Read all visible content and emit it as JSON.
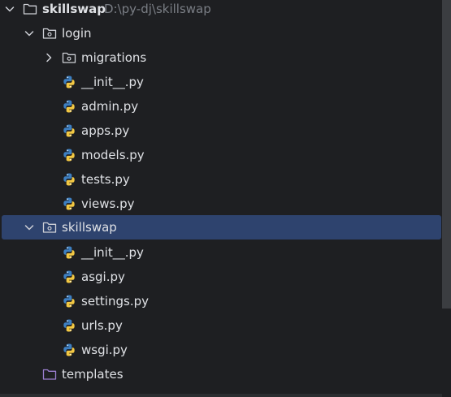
{
  "root": {
    "label": "skillswap",
    "path": "D:\\py-dj\\skillswap"
  },
  "login": {
    "label": "login"
  },
  "migrations": {
    "label": "migrations"
  },
  "login_files": [
    "__init__.py",
    "admin.py",
    "apps.py",
    "models.py",
    "tests.py",
    "views.py"
  ],
  "skillswap": {
    "label": "skillswap"
  },
  "skillswap_files": [
    "__init__.py",
    "asgi.py",
    "settings.py",
    "urls.py",
    "wsgi.py"
  ],
  "templates": {
    "label": "templates"
  },
  "colors": {
    "background": "#1e1f22",
    "selection": "#2e436e",
    "text": "#dfe1e5",
    "path_text": "#7a7e85",
    "templates_folder": "#9b7fd0",
    "scrollbar": "#3b3d41"
  },
  "icons": {
    "expanded": "chevron-down-icon",
    "collapsed": "chevron-right-icon",
    "folder": "folder-icon",
    "package": "package-folder-icon",
    "python_file": "python-file-icon",
    "templates": "templates-folder-icon"
  }
}
